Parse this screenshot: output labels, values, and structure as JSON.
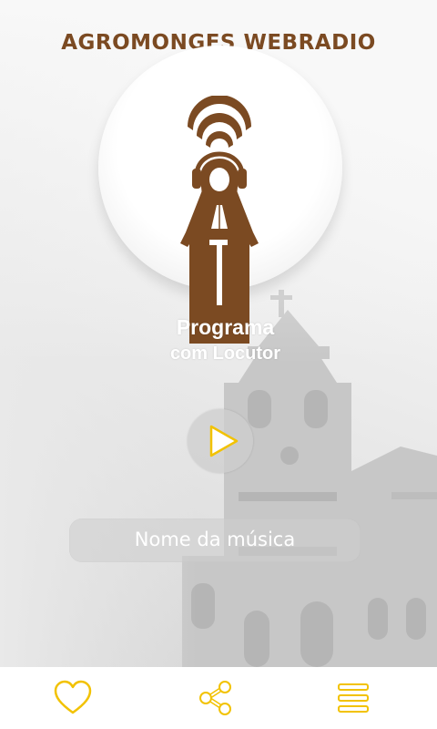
{
  "header": {
    "title": "AGROMONGES WEBRADIO"
  },
  "logo": {
    "icon": "monk-headphones-logo-icon",
    "color": "#7b4a22"
  },
  "program": {
    "name": "Programa",
    "host": "com Locutor"
  },
  "player": {
    "play_icon": "play-icon",
    "song_name": "Nome da música"
  },
  "bottom_nav": {
    "items": [
      {
        "icon": "heart-icon"
      },
      {
        "icon": "share-icon"
      },
      {
        "icon": "menu-icon"
      }
    ],
    "icon_color": "#f2c200"
  },
  "colors": {
    "accent": "#7b4a22",
    "highlight": "#f2c200"
  }
}
